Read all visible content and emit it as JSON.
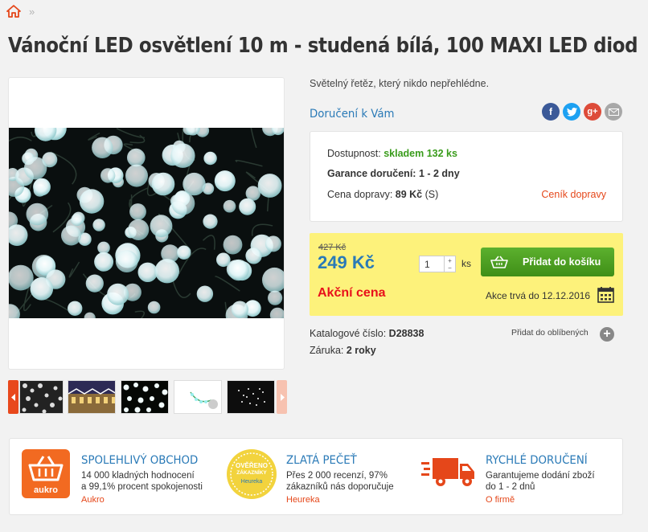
{
  "breadcrumb": {
    "separator": "»"
  },
  "product": {
    "title": "Vánoční LED osvětlení 10 m - studená bílá, 100 MAXI LED diod",
    "short_description": "Světelný řetěz, který nikdo nepřehlédne."
  },
  "delivery": {
    "title": "Doručení k Vám",
    "availability_label": "Dostupnost: ",
    "availability_value": "skladem 132 ks",
    "guarantee_label": "Garance doručení: ",
    "guarantee_value": "1 - 2 dny",
    "shipping_label": "Cena dopravy: ",
    "shipping_value": "89 Kč",
    "shipping_suffix": " (S)",
    "shipping_link": "Ceník dopravy"
  },
  "social": [
    "facebook-icon",
    "twitter-icon",
    "google-plus-icon",
    "email-icon"
  ],
  "pricing": {
    "old_price": "427 Kč",
    "price": "249 Kč",
    "quantity": "1",
    "unit": "ks",
    "add_to_cart": "Přidat do košíku",
    "sale_label": "Akční cena",
    "sale_until": "Akce trvá do 12.12.2016"
  },
  "details": {
    "catalog_label": "Katalogové číslo: ",
    "catalog_value": "D28838",
    "warranty_label": "Záruka: ",
    "warranty_value": "2 roky",
    "favorite": "Přidat do oblíbených"
  },
  "trust": {
    "aukro_logo": "aukro",
    "heureka_seal": [
      "OVĚŘENO",
      "ZÁKAZNÍKY",
      "Heureka"
    ],
    "items": [
      {
        "title": "SPOLEHLIVÝ OBCHOD",
        "line1": "14 000 kladných hodnocení",
        "line2": "a 99,1% procent spokojenosti",
        "link": "Aukro"
      },
      {
        "title": "ZLATÁ PEČEŤ",
        "line1": "Přes 2 000 recenzí, 97%",
        "line2": "zákazníků nás doporučuje",
        "link": "Heureka"
      },
      {
        "title": "RYCHLÉ DORUČENÍ",
        "line1": "Garantujeme dodání zboží",
        "line2": "do 1 - 2 dnů",
        "link": "O firmě"
      }
    ]
  },
  "colors": {
    "accent": "#2a7ab7",
    "orange": "#e5471a",
    "green": "#4ca024",
    "yellow": "#fdf27b",
    "sale_red": "#e8101b"
  }
}
